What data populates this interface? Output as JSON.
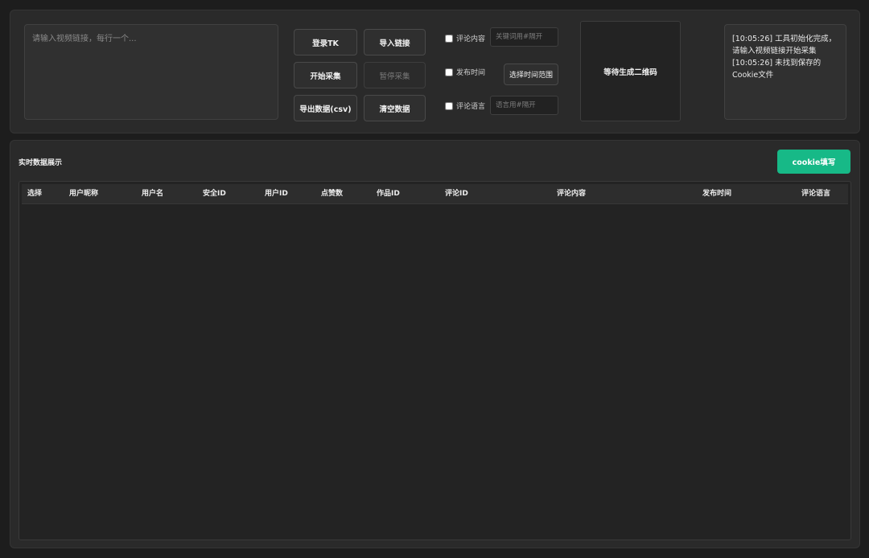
{
  "top": {
    "links_placeholder": "请输入视频链接，每行一个...",
    "buttons": {
      "login": "登录TK",
      "import_links": "导入链接",
      "start": "开始采集",
      "pause": "暂停采集",
      "export": "导出数据(csv)",
      "clear": "清空数据",
      "time_range": "选择时间范围"
    },
    "options": {
      "comment_content_label": "评论内容",
      "comment_content_checked": false,
      "keyword_placeholder": "关键词用#隔开",
      "publish_time_label": "发布时间",
      "publish_time_checked": false,
      "comment_language_label": "评论语言",
      "comment_language_checked": false,
      "language_placeholder": "语言用#隔开"
    },
    "qr_text": "等待生成二维码",
    "log": [
      "[10:05:26] 工具初始化完成，",
      "请输入视频链接开始采集",
      "[10:05:26] 未找到保存的",
      "Cookie文件"
    ]
  },
  "data_panel": {
    "title": "实时数据展示",
    "cookie_button": "cookie填写",
    "accent": "#17b987",
    "columns": [
      "选择",
      "用户昵称",
      "用户名",
      "安全ID",
      "用户ID",
      "点赞数",
      "作品ID",
      "评论ID",
      "评论内容",
      "发布时间",
      "评论语言"
    ],
    "rows": []
  }
}
